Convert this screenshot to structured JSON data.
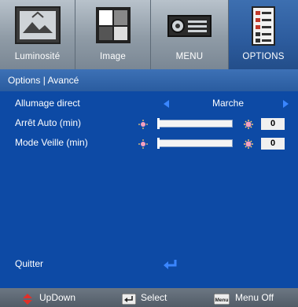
{
  "tabs": [
    {
      "label": "Luminosité",
      "icon": "picture-frame-icon"
    },
    {
      "label": "Image",
      "icon": "image-grid-icon"
    },
    {
      "label": "MENU",
      "icon": "projector-icon"
    },
    {
      "label": "OPTIONS",
      "icon": "options-list-icon",
      "active": true
    }
  ],
  "breadcrumb": "Options | Avancé",
  "rows": [
    {
      "label": "Allumage direct",
      "value": "Marche"
    },
    {
      "label": "Arrêt Auto (min)",
      "value": "0",
      "level": 0
    },
    {
      "label": "Mode Veille (min)",
      "value": "0",
      "level": 0
    }
  ],
  "quit_label": "Quitter",
  "footer": {
    "updown": "UpDown",
    "select": "Select",
    "menu_off": "Menu Off",
    "menu_key_label": "Menu"
  },
  "colors": {
    "panel": "#0d4aa5",
    "active_tab": "#2c5b9d",
    "arrow": "#3a86ff"
  }
}
